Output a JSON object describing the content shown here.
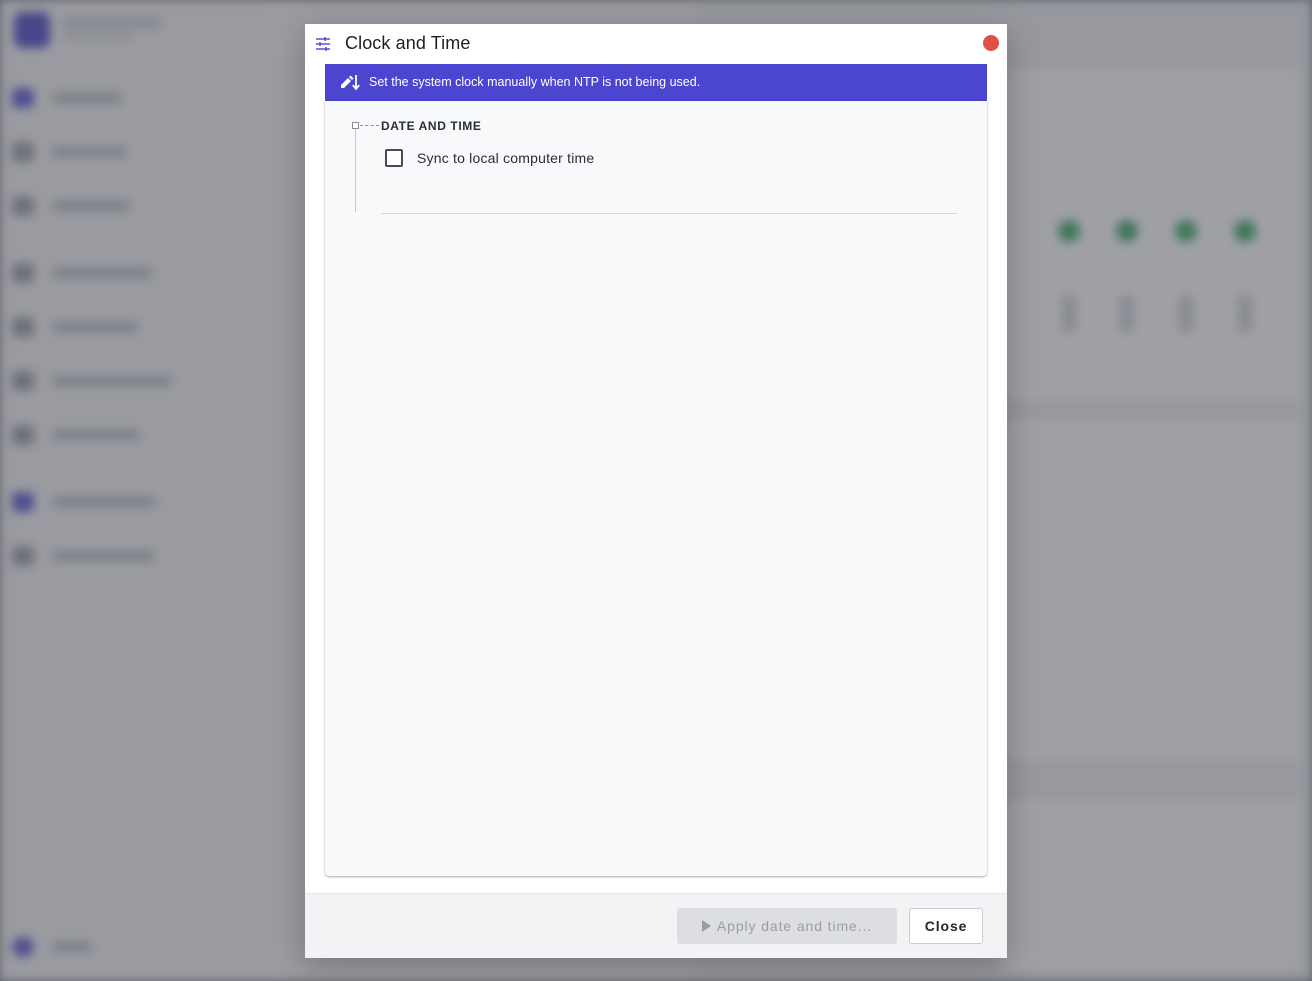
{
  "dialog": {
    "title": "Clock and Time",
    "title_icon": "sliders-icon",
    "close_color": "#e0504a"
  },
  "banner": {
    "icon": "pen-arrow-down-icon",
    "text": "Set the system clock manually when NTP is not being used.",
    "color": "#4c45cf"
  },
  "section": {
    "title": "DATE AND TIME",
    "checkbox_label": "Sync to local computer time",
    "checkbox_checked": false
  },
  "footer": {
    "apply_label": "Apply date and time...",
    "apply_icon": "play-icon",
    "close_label": "Close"
  }
}
